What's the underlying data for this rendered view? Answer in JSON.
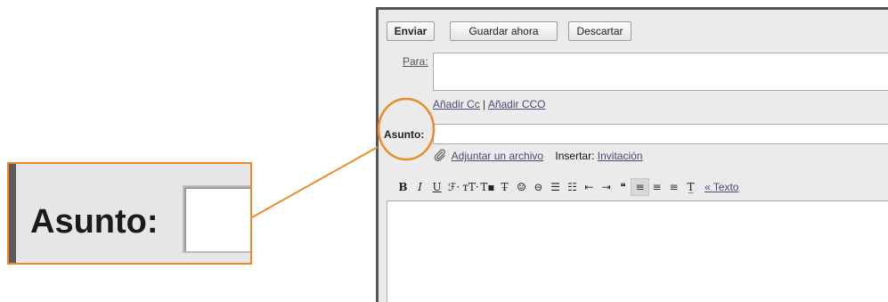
{
  "callout": {
    "label": "Asunto:"
  },
  "buttons": {
    "send": "Enviar",
    "save": "Guardar ahora",
    "discard": "Descartar"
  },
  "fields": {
    "to_label": "Para:",
    "to_value": "",
    "add_cc": "Añadir Cc",
    "separator": "|",
    "add_bcc": "Añadir CCO",
    "subject_label": "Asunto:",
    "subject_value": ""
  },
  "attach": {
    "icon": "paperclip-icon",
    "attach_link": "Adjuntar un archivo",
    "insert_label": "Insertar:",
    "insert_link": "Invitación"
  },
  "format_toolbar": {
    "items": [
      {
        "name": "bold-icon",
        "glyph": "B"
      },
      {
        "name": "italic-icon",
        "glyph": "I"
      },
      {
        "name": "underline-icon",
        "glyph": "U"
      },
      {
        "name": "font-icon",
        "glyph": "ℱ·"
      },
      {
        "name": "font-size-icon",
        "glyph": "тT·"
      },
      {
        "name": "text-color-icon",
        "glyph": "T▪"
      },
      {
        "name": "highlight-icon",
        "glyph": "T̶"
      },
      {
        "name": "emoji-icon",
        "glyph": "☺"
      },
      {
        "name": "link-icon",
        "glyph": "⊝"
      },
      {
        "name": "numbered-list-icon",
        "glyph": "☰"
      },
      {
        "name": "bulleted-list-icon",
        "glyph": "☷"
      },
      {
        "name": "indent-less-icon",
        "glyph": "⇤"
      },
      {
        "name": "indent-more-icon",
        "glyph": "⇥"
      },
      {
        "name": "quote-icon",
        "glyph": "❝"
      },
      {
        "name": "align-left-icon",
        "glyph": "≡"
      },
      {
        "name": "align-center-icon",
        "glyph": "≡"
      },
      {
        "name": "align-right-icon",
        "glyph": "≡"
      },
      {
        "name": "remove-format-icon",
        "glyph": "T̲"
      }
    ],
    "plain_text_link": "« Texto"
  }
}
